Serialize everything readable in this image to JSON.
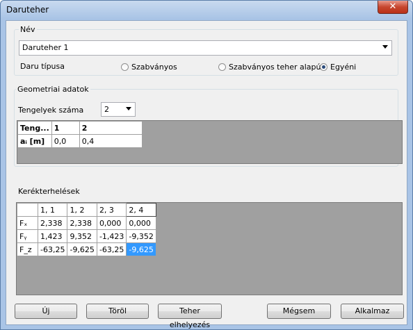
{
  "window": {
    "title": "Daruteher",
    "close_glyph": "✕"
  },
  "nev": {
    "label": "Név",
    "value": "Daruteher 1"
  },
  "daru_tipusa": {
    "label": "Daru típusa",
    "options": [
      {
        "label": "Szabványos",
        "selected": false
      },
      {
        "label": "Szabványos teher alapú",
        "selected": false
      },
      {
        "label": "Egyéni",
        "selected": true
      }
    ]
  },
  "geometriai": {
    "title": "Geometriai adatok",
    "tengelyek_label": "Tengelyek száma",
    "tengelyek_value": "2",
    "table": {
      "header": [
        "Teng...",
        "1",
        "2"
      ],
      "rows": [
        [
          "aᵢ [m]",
          "0,0",
          "0,4"
        ]
      ]
    }
  },
  "kerekterhelesek": {
    "title": "Kerékterhelések",
    "header": [
      "",
      "1, 1",
      "1, 2",
      "2, 3",
      "2, 4"
    ],
    "rows": [
      [
        "Fₓ",
        "2,338",
        "2,338",
        "0,000",
        "0,000"
      ],
      [
        "Fᵧ",
        "1,423",
        "9,352",
        "-1,423",
        "-9,352"
      ],
      [
        "F_z",
        "-63,25",
        "-9,625",
        "-63,25",
        "-9,625"
      ]
    ]
  },
  "buttons": {
    "uj": "Új",
    "torol": "Töröl",
    "teher": "Teher elhelyezés",
    "megsem": "Mégsem",
    "alkalmaz": "Alkalmaz"
  },
  "colors": {
    "selection": "#3399ff",
    "grid_bg": "#a0a0a0"
  }
}
